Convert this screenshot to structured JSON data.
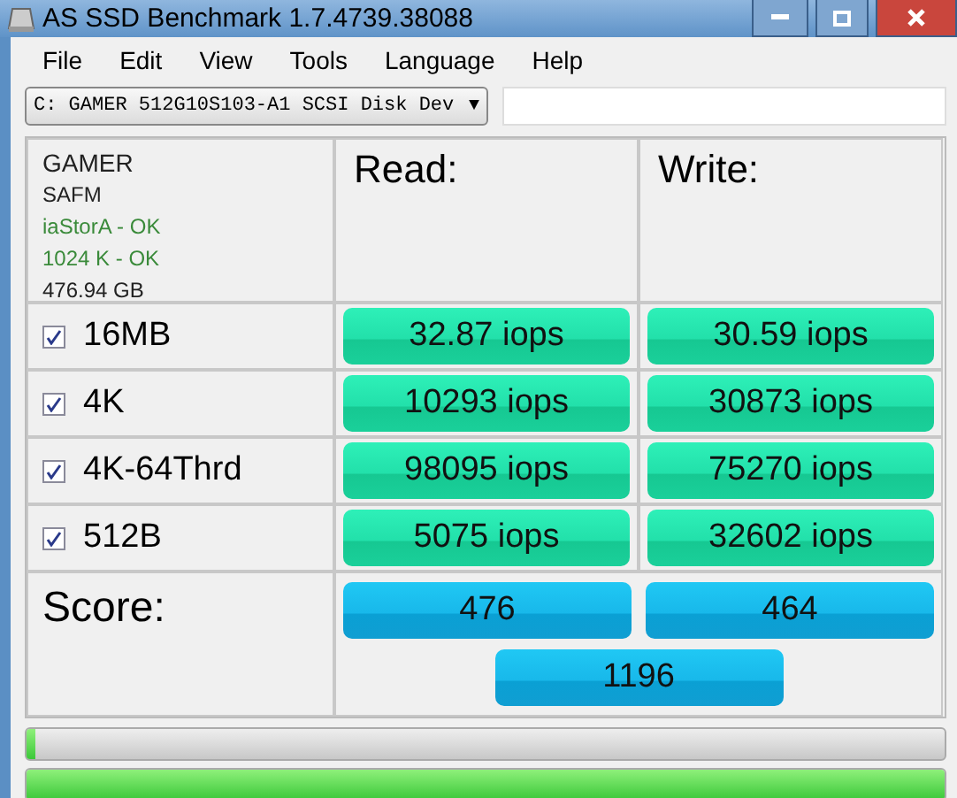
{
  "window": {
    "title": "AS SSD Benchmark 1.7.4739.38088"
  },
  "menu": [
    "File",
    "Edit",
    "View",
    "Tools",
    "Language",
    "Help"
  ],
  "drive_select": {
    "value": "C: GAMER 512G10S103-A1 SCSI Disk Dev",
    "caret": "▼"
  },
  "drive_info": [
    {
      "text": "GAMER",
      "ok": false
    },
    {
      "text": "SAFM",
      "ok": false
    },
    {
      "text": "iaStorA - OK",
      "ok": true
    },
    {
      "text": "1024 K - OK",
      "ok": true
    },
    {
      "text": "476.94 GB",
      "ok": false
    }
  ],
  "columns": [
    "Read:",
    "Write:"
  ],
  "tests": [
    {
      "name": "16MB",
      "checked": true,
      "read": "32.87 iops",
      "write": "30.59 iops"
    },
    {
      "name": "4K",
      "checked": true,
      "read": "10293 iops",
      "write": "30873 iops"
    },
    {
      "name": "4K-64Thrd",
      "checked": true,
      "read": "98095 iops",
      "write": "75270 iops"
    },
    {
      "name": "512B",
      "checked": true,
      "read": "5075 iops",
      "write": "32602 iops"
    }
  ],
  "score": {
    "label": "Score:",
    "read": "476",
    "write": "464",
    "total": "1196"
  },
  "progress_bars": [
    {
      "level": 0.01
    },
    {
      "level": 1
    }
  ]
}
